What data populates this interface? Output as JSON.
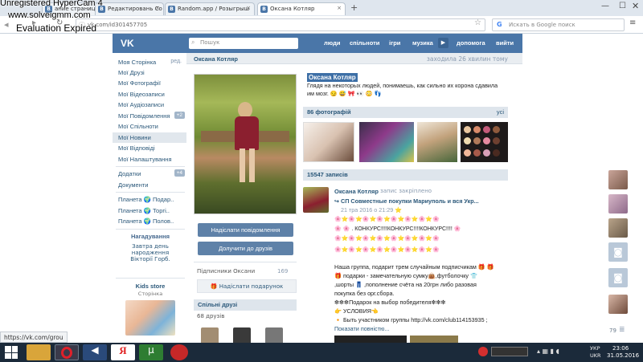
{
  "watermark": {
    "line1": "Unregistered HyperCam 4",
    "line2": "www.solveigmm.com",
    "line3": "Evaluation Expired"
  },
  "browser": {
    "tabs": [
      {
        "label": "ание страницы Отслеживание и Сост"
      },
      {
        "label": "Редактировань Со"
      },
      {
        "label": "Random.app / Розыгрыш"
      },
      {
        "label": "Оксана Котляр"
      }
    ],
    "url": "vk.com/id301457705",
    "search_placeholder": "Искать в Google поиск",
    "status_url": "https://vk.com/grou"
  },
  "vk": {
    "logo": "VK",
    "search_placeholder": "Пошук",
    "nav": [
      "люди",
      "спільноти",
      "ігри",
      "музика",
      "допомога",
      "вийти"
    ]
  },
  "sidebar": {
    "items": [
      {
        "label": "Моя Сторінка",
        "extra": "ред."
      },
      {
        "label": "Мої Друзі"
      },
      {
        "label": "Мої Фотографії"
      },
      {
        "label": "Мої Відеозаписи"
      },
      {
        "label": "Мої Аудіозаписи"
      },
      {
        "label": "Мої Повідомлення",
        "badge": "+2"
      },
      {
        "label": "Мої Спільноти"
      },
      {
        "label": "Мої Новини"
      },
      {
        "label": "Мої Відповіді"
      },
      {
        "label": "Мої Налаштування"
      }
    ],
    "apps": [
      {
        "label": "Додатки",
        "badge": "+4"
      },
      {
        "label": "Документи"
      }
    ],
    "games": [
      {
        "label": "Планета 🌍 Подар.."
      },
      {
        "label": "Планета 🌍 Торгі.."
      },
      {
        "label": "Планета 🌍 Полов.."
      }
    ],
    "reminder": {
      "title": "Нагадування",
      "text1": "Завтра день",
      "text2": "народження",
      "text3": "Вікторії Горб."
    },
    "store": {
      "title": "Kids store",
      "sub": "Сторінка"
    }
  },
  "profile": {
    "name": "Оксана Котляр",
    "last_seen": "заходила 26 хвилин тому",
    "status_line1": "Глядя на некоторых людей, понимаешь, как сильно их корона сдавила",
    "status_line2": "им мозг. 😏 😅 🎀 👀 😳 👣",
    "btn_message": "Надіслати повідомлення",
    "btn_friend": "Долучити до друзів",
    "subscribers_label": "Підписники Оксани",
    "subscribers_count": "169",
    "gift_btn": "Надіслати подарунок",
    "common_friends": "Спільні друзі",
    "common_count": "68 друзів",
    "photos_header": "86 фотографій",
    "photos_all": "усі",
    "wall_header": "15547 записів"
  },
  "post": {
    "author": "Оксана Котляр",
    "pinned": "запис закріплено",
    "repost": "↪ СП Совместные покупки Мариуполь и вся Укр...",
    "date": "21 тра 2016 о 21:29 ⭐",
    "deco": "🌸⭐🌸⭐🌸⭐🌸⭐🌸⭐🌸⭐🌸⭐🌸",
    "contest": "🌸 🌸 . КОНКУРС!!!!КОНКУРС!!!!КОНКУРС!!!! 🌸",
    "line1": "Наша группа, подарит трем случайным подписчикам 🎁 🎁",
    "line2": "🎁 подарки - замечательную сумку👜,футболочку 👕",
    "line3": ",шорты 👖 ,пополнение счёта на 20грн либо разовая",
    "line4": "покупка без орг.сбора.",
    "line5": "❇❇❇Подарок на выбор победителя❇❇❇",
    "line6": "👉 УСЛОВИЯ👈",
    "line7": "🔸 Быть участником группы http://vk.com/club114153935 ;",
    "more": "Показати повністю..."
  },
  "right_counter": "79",
  "taskbar": {
    "lang": "УКР",
    "lang2": "UKR",
    "time": "23:06",
    "date": "31.05.2016"
  }
}
